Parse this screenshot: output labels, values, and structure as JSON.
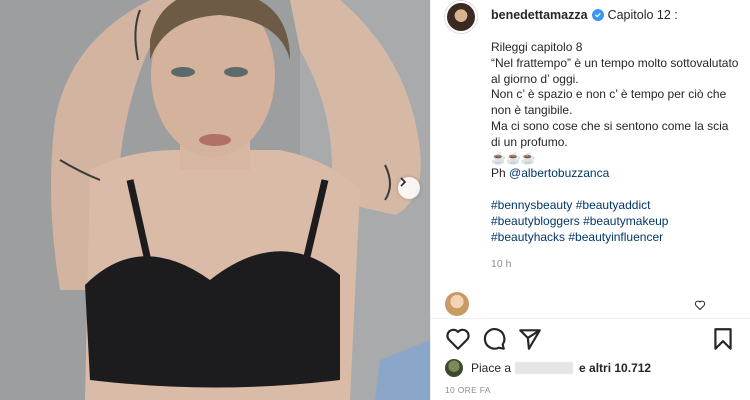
{
  "post": {
    "username": "benedettamazza",
    "caption_title": "Capitolo 12 :",
    "caption_lines": [
      "Rileggi capitolo 8",
      "“Nel frattempo” è un tempo molto sottovalutato al giorno d’ oggi.",
      "Non c’ è spazio e non c’ è tempo per ciò che non è tangibile.",
      "Ma ci sono cose che si sentono come la scia di un profumo.",
      "☕☕☕"
    ],
    "ph_prefix": "Ph",
    "ph_mention": "@albertobuzzanca",
    "hashtags_line1": "#bennysbeauty #beautyaddict",
    "hashtags_line2": "#beautybloggers #beautymakeup",
    "hashtags_line3": "#beautyhacks #beautyinfluencer",
    "relative_time": "10 h",
    "likes_prefix": "Piace a",
    "likes_suffix": "e altri 10.712",
    "timestamp": "10 ORE FA"
  },
  "icons": {
    "verified": "verified-badge-icon",
    "next": "chevron-right-icon",
    "like": "heart-icon",
    "comment": "comment-bubble-icon",
    "share": "paper-plane-icon",
    "save": "bookmark-icon"
  },
  "colors": {
    "link": "#00376b",
    "verified": "#3897f0",
    "muted": "#8e8e8e"
  }
}
